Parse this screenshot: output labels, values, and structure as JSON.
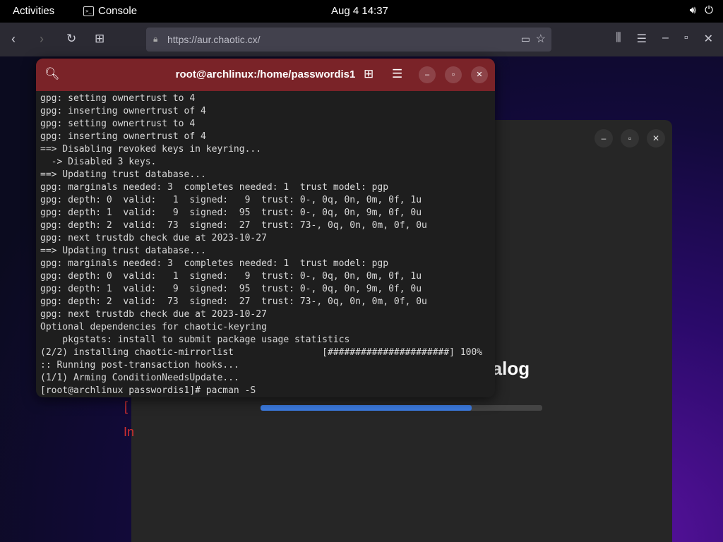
{
  "topbar": {
    "activities": "Activities",
    "app_name": "Console",
    "app_icon_glyph": ">_",
    "clock": "Aug 4  14:37",
    "volume_icon": "volume-icon",
    "power_icon": "power-icon"
  },
  "browser": {
    "url": "https://aur.chaotic.cx/",
    "lock_icon": "lock-icon"
  },
  "dialog": {
    "title_fragment": "talog",
    "progress_fraction": 0.75,
    "progress_color": "#3c7be0",
    "red_text_1": "[",
    "red_text_2": "In"
  },
  "terminal": {
    "title": "root@archlinux:/home/passwordis1",
    "header_color": "#7a2328",
    "lines": [
      "gpg: setting ownertrust to 4",
      "gpg: inserting ownertrust of 4",
      "gpg: setting ownertrust to 4",
      "gpg: inserting ownertrust of 4",
      "==> Disabling revoked keys in keyring...",
      "  -> Disabled 3 keys.",
      "==> Updating trust database...",
      "gpg: marginals needed: 3  completes needed: 1  trust model: pgp",
      "gpg: depth: 0  valid:   1  signed:   9  trust: 0-, 0q, 0n, 0m, 0f, 1u",
      "gpg: depth: 1  valid:   9  signed:  95  trust: 0-, 0q, 0n, 9m, 0f, 0u",
      "gpg: depth: 2  valid:  73  signed:  27  trust: 73-, 0q, 0n, 0m, 0f, 0u",
      "gpg: next trustdb check due at 2023-10-27",
      "==> Updating trust database...",
      "gpg: marginals needed: 3  completes needed: 1  trust model: pgp",
      "gpg: depth: 0  valid:   1  signed:   9  trust: 0-, 0q, 0n, 0m, 0f, 1u",
      "gpg: depth: 1  valid:   9  signed:  95  trust: 0-, 0q, 0n, 9m, 0f, 0u",
      "gpg: depth: 2  valid:  73  signed:  27  trust: 73-, 0q, 0n, 0m, 0f, 0u",
      "gpg: next trustdb check due at 2023-10-27",
      "Optional dependencies for chaotic-keyring",
      "    pkgstats: install to submit package usage statistics",
      "(2/2) installing chaotic-mirrorlist                [######################] 100%",
      ":: Running post-transaction hooks...",
      "(1/1) Arming ConditionNeedsUpdate...",
      "[root@archlinux passwordis1]# pacman -S"
    ]
  }
}
